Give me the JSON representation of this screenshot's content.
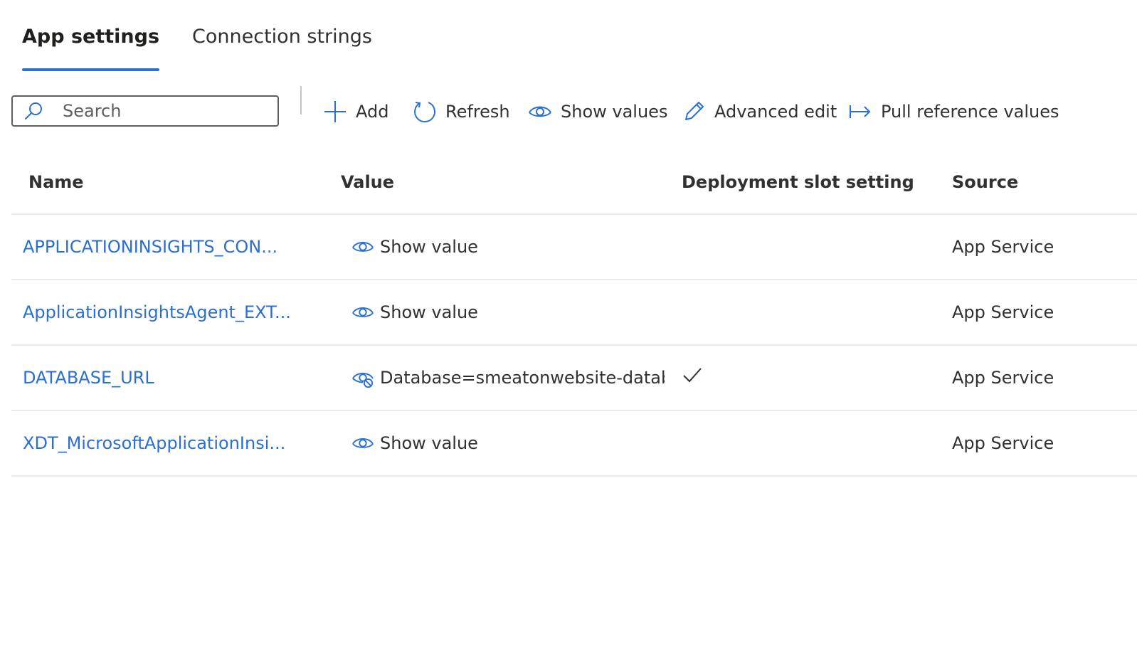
{
  "tabs": [
    {
      "label": "App settings",
      "active": true
    },
    {
      "label": "Connection strings",
      "active": false
    }
  ],
  "toolbar": {
    "search_placeholder": "Search",
    "add_label": "Add",
    "refresh_label": "Refresh",
    "show_values_label": "Show values",
    "advanced_edit_label": "Advanced edit",
    "pull_reference_label": "Pull reference values"
  },
  "grid": {
    "columns": {
      "name": "Name",
      "value": "Value",
      "slot": "Deployment slot setting",
      "source": "Source"
    },
    "rows": [
      {
        "name": "APPLICATIONINSIGHTS_CON...",
        "value": "Show value",
        "value_hidden": true,
        "slot_setting": false,
        "source": "App Service"
      },
      {
        "name": "ApplicationInsightsAgent_EXT...",
        "value": "Show value",
        "value_hidden": true,
        "slot_setting": false,
        "source": "App Service"
      },
      {
        "name": "DATABASE_URL",
        "value": "Database=smeatonwebsite-databas",
        "value_hidden": false,
        "slot_setting": true,
        "source": "App Service"
      },
      {
        "name": "XDT_MicrosoftApplicationInsi...",
        "value": "Show value",
        "value_hidden": true,
        "slot_setting": false,
        "source": "App Service"
      }
    ]
  },
  "colors": {
    "accent": "#2a6fd3",
    "text": "#323130",
    "divider": "#edebe9"
  }
}
